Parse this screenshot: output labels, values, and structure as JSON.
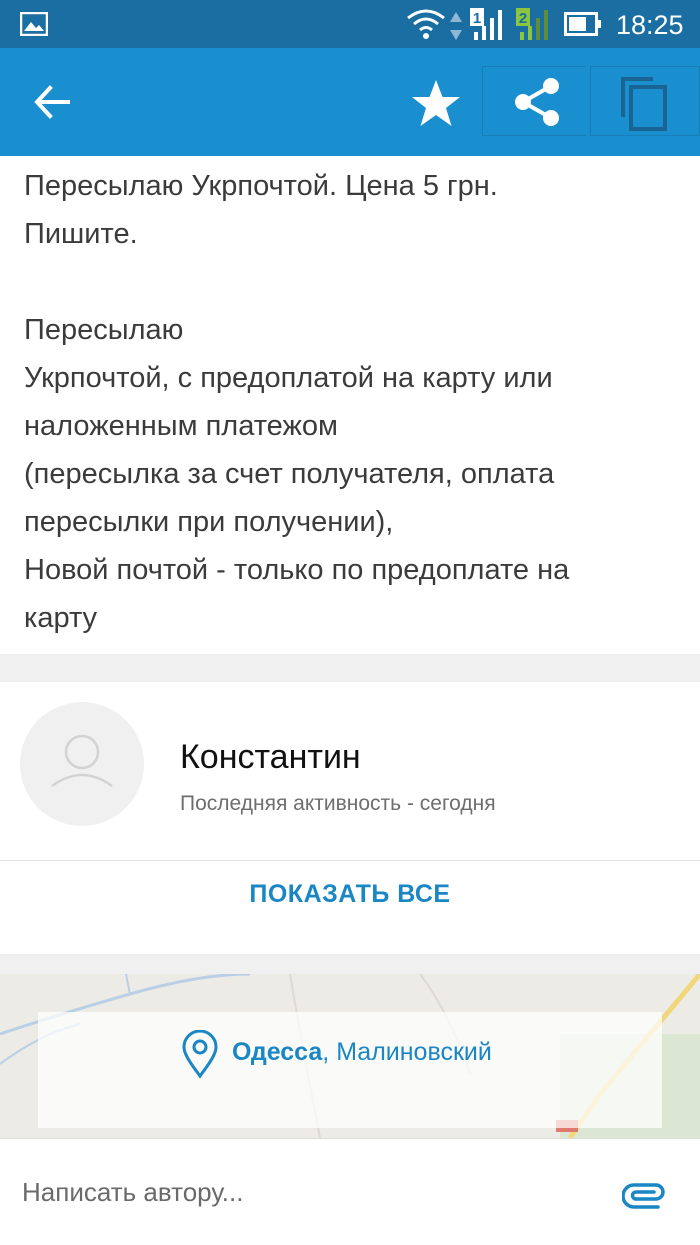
{
  "status_bar": {
    "time": "18:25",
    "sim1_label": "1",
    "sim2_label": "2",
    "icons": [
      "gallery-icon",
      "wifi-icon",
      "signal-sim1-icon",
      "signal-sim2-icon",
      "battery-icon"
    ]
  },
  "app_bar": {
    "icons": [
      "back-arrow-icon",
      "star-icon",
      "share-icon",
      "copy-icon"
    ],
    "color": "#1a8fd0"
  },
  "description": {
    "line1": "Пересылаю Укрпочтой. Цена 5 грн.",
    "line2": "Пишите.",
    "para2_line1": "Пересылаю",
    "para2_line2": "Укрпочтой, с предоплатой на карту или",
    "para2_line3": "наложенным платежом",
    "para2_line4": "(пересылка за счет получателя, оплата",
    "para2_line5": "пересылки при получении),",
    "para2_line6": "Новой почтой - только по предоплате на",
    "para2_line7": "карту"
  },
  "seller": {
    "name": "Константин",
    "activity": "Последняя активность - сегодня",
    "show_all_label": "ПОКАЗАТЬ ВСЕ"
  },
  "location": {
    "city": "Одесса",
    "district": ", Малиновский"
  },
  "message": {
    "placeholder": "Написать автору..."
  },
  "colors": {
    "status_bar": "#1a6ea1",
    "accent": "#1a86c4"
  }
}
